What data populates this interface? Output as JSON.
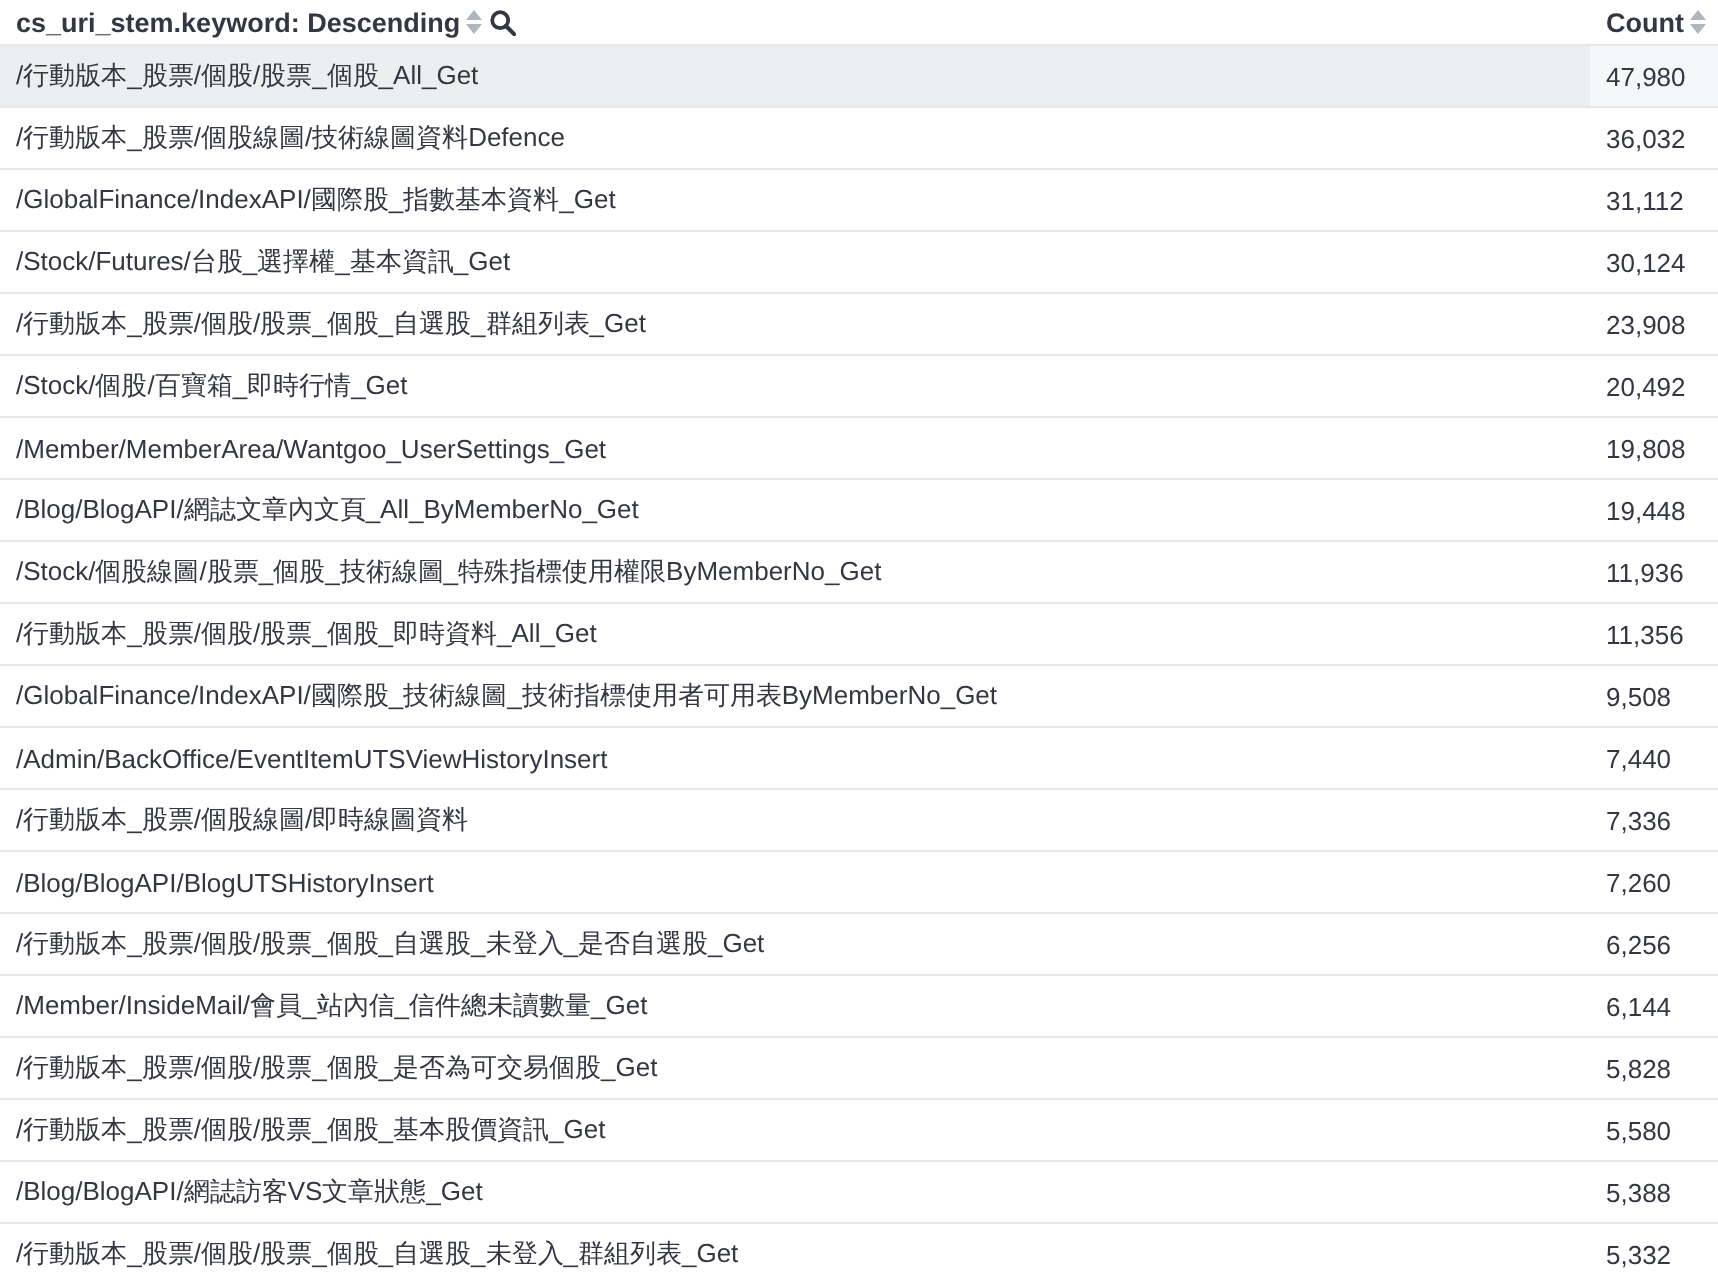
{
  "table": {
    "columns": [
      {
        "label": "cs_uri_stem.keyword: Descending",
        "sortable": true,
        "searchable": true
      },
      {
        "label": "Count",
        "sortable": true,
        "searchable": false
      }
    ],
    "rows": [
      {
        "uri": "/行動版本_股票/個股/股票_個股_All_Get",
        "count": "47,980",
        "selected": true
      },
      {
        "uri": "/行動版本_股票/個股線圖/技術線圖資料Defence",
        "count": "36,032",
        "selected": false
      },
      {
        "uri": "/GlobalFinance/IndexAPI/國際股_指數基本資料_Get",
        "count": "31,112",
        "selected": false
      },
      {
        "uri": "/Stock/Futures/台股_選擇權_基本資訊_Get",
        "count": "30,124",
        "selected": false
      },
      {
        "uri": "/行動版本_股票/個股/股票_個股_自選股_群組列表_Get",
        "count": "23,908",
        "selected": false
      },
      {
        "uri": "/Stock/個股/百寶箱_即時行情_Get",
        "count": "20,492",
        "selected": false
      },
      {
        "uri": "/Member/MemberArea/Wantgoo_UserSettings_Get",
        "count": "19,808",
        "selected": false
      },
      {
        "uri": "/Blog/BlogAPI/網誌文章內文頁_All_ByMemberNo_Get",
        "count": "19,448",
        "selected": false
      },
      {
        "uri": "/Stock/個股線圖/股票_個股_技術線圖_特殊指標使用權限ByMemberNo_Get",
        "count": "11,936",
        "selected": false
      },
      {
        "uri": "/行動版本_股票/個股/股票_個股_即時資料_All_Get",
        "count": "11,356",
        "selected": false
      },
      {
        "uri": "/GlobalFinance/IndexAPI/國際股_技術線圖_技術指標使用者可用表ByMemberNo_Get",
        "count": "9,508",
        "selected": false
      },
      {
        "uri": "/Admin/BackOffice/EventItemUTSViewHistoryInsert",
        "count": "7,440",
        "selected": false
      },
      {
        "uri": "/行動版本_股票/個股線圖/即時線圖資料",
        "count": "7,336",
        "selected": false
      },
      {
        "uri": "/Blog/BlogAPI/BlogUTSHistoryInsert",
        "count": "7,260",
        "selected": false
      },
      {
        "uri": "/行動版本_股票/個股/股票_個股_自選股_未登入_是否自選股_Get",
        "count": "6,256",
        "selected": false
      },
      {
        "uri": "/Member/InsideMail/會員_站內信_信件總未讀數量_Get",
        "count": "6,144",
        "selected": false
      },
      {
        "uri": "/行動版本_股票/個股/股票_個股_是否為可交易個股_Get",
        "count": "5,828",
        "selected": false
      },
      {
        "uri": "/行動版本_股票/個股/股票_個股_基本股價資訊_Get",
        "count": "5,580",
        "selected": false
      },
      {
        "uri": "/Blog/BlogAPI/網誌訪客VS文章狀態_Get",
        "count": "5,388",
        "selected": false
      },
      {
        "uri": "/行動版本_股票/個股/股票_個股_自選股_未登入_群組列表_Get",
        "count": "5,332",
        "selected": false
      }
    ]
  }
}
